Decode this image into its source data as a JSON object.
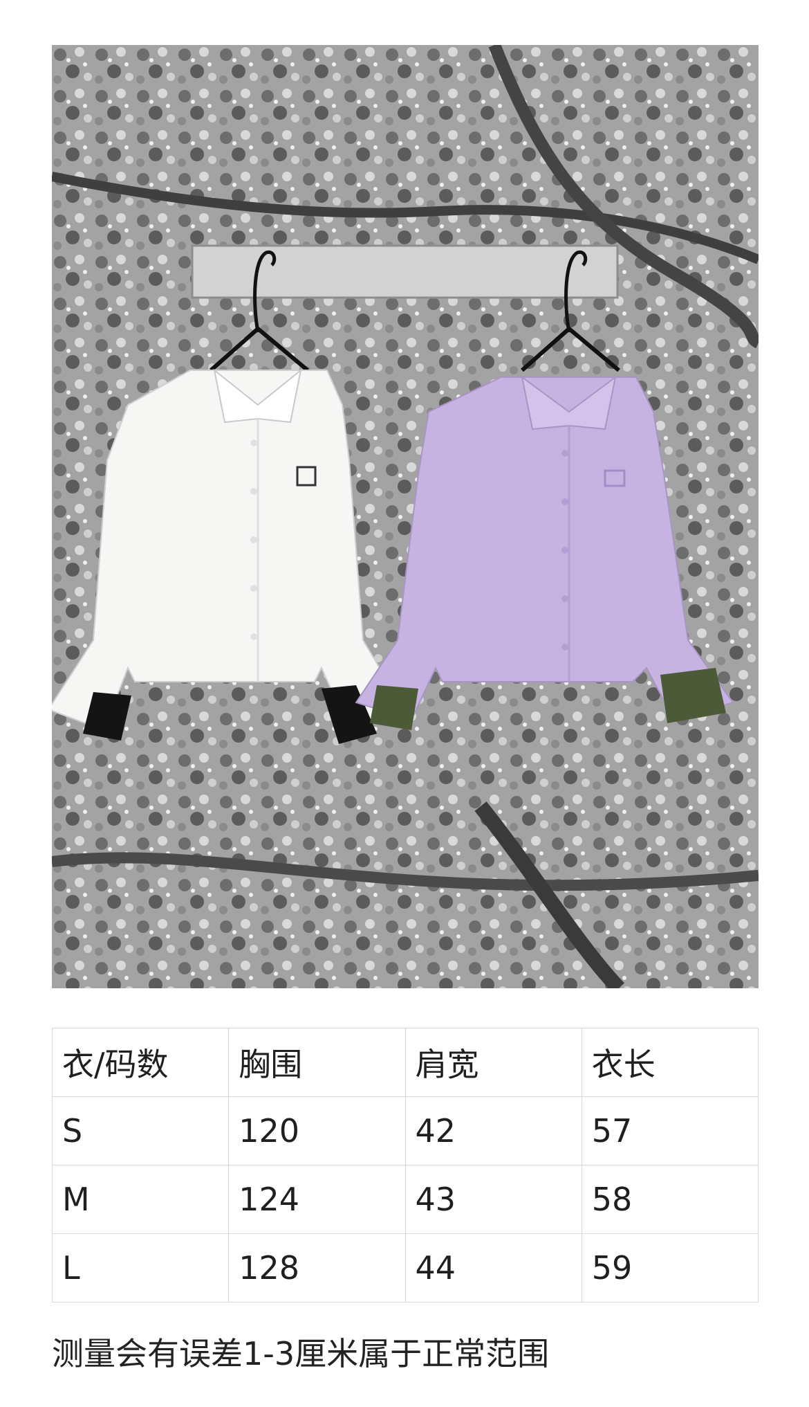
{
  "product_photo": {
    "items": [
      "white-shirt",
      "lilac-shirt"
    ],
    "colors": {
      "background_toile": "#9a9a9a",
      "white_shirt": "#f6f6f4",
      "white_shirt_cuff": "#141414",
      "lilac_shirt": "#c7b3e2",
      "lilac_shirt_cuff": "#4d5a37",
      "logo_embroidery": "#333333"
    }
  },
  "size_table": {
    "headers": [
      "衣/码数",
      "胸围",
      "肩宽",
      "衣长"
    ],
    "rows": [
      [
        "S",
        "120",
        "42",
        "57"
      ],
      [
        "M",
        "124",
        "43",
        "58"
      ],
      [
        "L",
        "128",
        "44",
        "59"
      ]
    ]
  },
  "note": "测量会有误差1-3厘米属于正常范围"
}
